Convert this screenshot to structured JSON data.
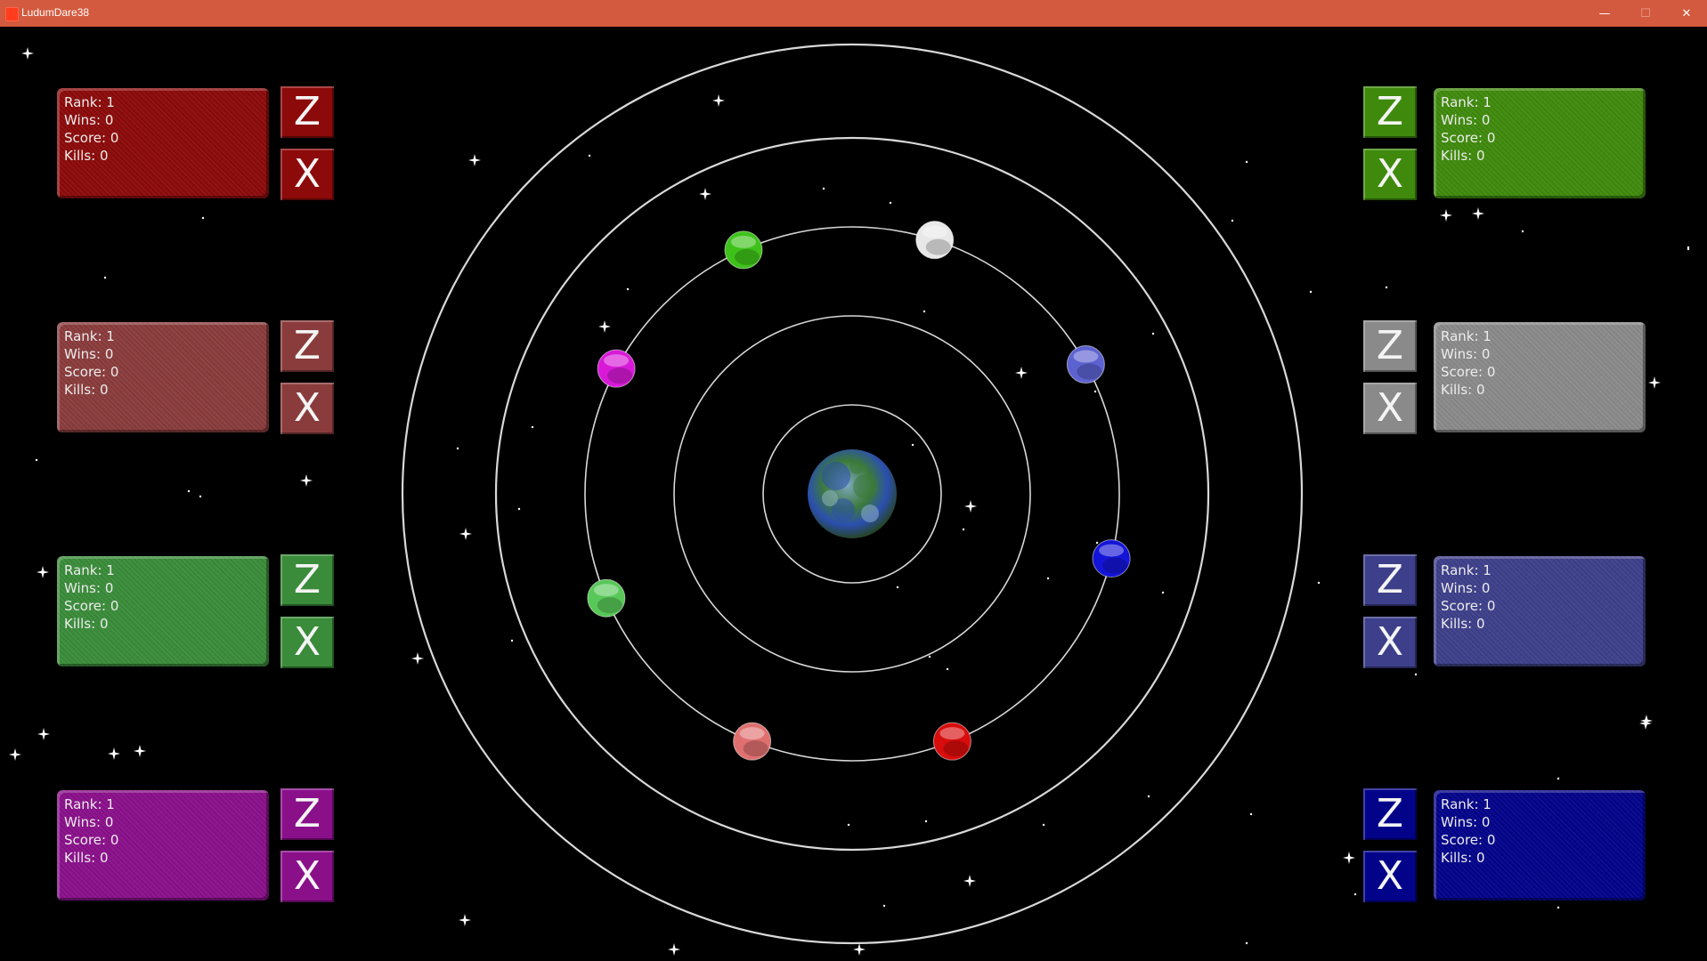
{
  "window": {
    "title": "LudumDare38",
    "minimize_label": "—",
    "maximize_label": "☐",
    "close_label": "✕"
  },
  "players": [
    {
      "id": "red",
      "color": "#8c0a0a",
      "rank": "Rank: 1",
      "wins": "Wins: 0",
      "score": "Score: 0",
      "kills": "Kills: 0",
      "key1": "Z",
      "key2": "X"
    },
    {
      "id": "rose",
      "color": "#8a3c3c",
      "rank": "Rank: 1",
      "wins": "Wins: 0",
      "score": "Score: 0",
      "kills": "Kills: 0",
      "key1": "Z",
      "key2": "X"
    },
    {
      "id": "lime",
      "color": "#3a8c3a",
      "rank": "Rank: 1",
      "wins": "Wins: 0",
      "score": "Score: 0",
      "kills": "Kills: 0",
      "key1": "Z",
      "key2": "X"
    },
    {
      "id": "magenta",
      "color": "#8a108a",
      "rank": "Rank: 1",
      "wins": "Wins: 0",
      "score": "Score: 0",
      "kills": "Kills: 0",
      "key1": "Z",
      "key2": "X"
    },
    {
      "id": "green",
      "color": "#3f8a0c",
      "rank": "Rank: 1",
      "wins": "Wins: 0",
      "score": "Score: 0",
      "kills": "Kills: 0",
      "key1": "Z",
      "key2": "X"
    },
    {
      "id": "gray",
      "color": "#8a8a8a",
      "rank": "Rank: 1",
      "wins": "Wins: 0",
      "score": "Score: 0",
      "kills": "Kills: 0",
      "key1": "Z",
      "key2": "X"
    },
    {
      "id": "periwinkle",
      "color": "#3d3f8a",
      "rank": "Rank: 1",
      "wins": "Wins: 0",
      "score": "Score: 0",
      "kills": "Kills: 0",
      "key1": "Z",
      "key2": "X"
    },
    {
      "id": "blue",
      "color": "#03038a",
      "rank": "Rank: 1",
      "wins": "Wins: 0",
      "score": "Score: 0",
      "kills": "Kills: 0",
      "key1": "Z",
      "key2": "X"
    }
  ],
  "planets": [
    {
      "color": "#3ec21a"
    },
    {
      "color": "#e8e8e8"
    },
    {
      "color": "#5c62d0"
    },
    {
      "color": "#d81ad8"
    },
    {
      "color": "#58c858"
    },
    {
      "color": "#1414d8"
    },
    {
      "color": "#e07070"
    },
    {
      "color": "#d80c0c"
    }
  ],
  "world": {
    "color_land": "#3c7a3a",
    "color_water": "#2b4fb0"
  }
}
